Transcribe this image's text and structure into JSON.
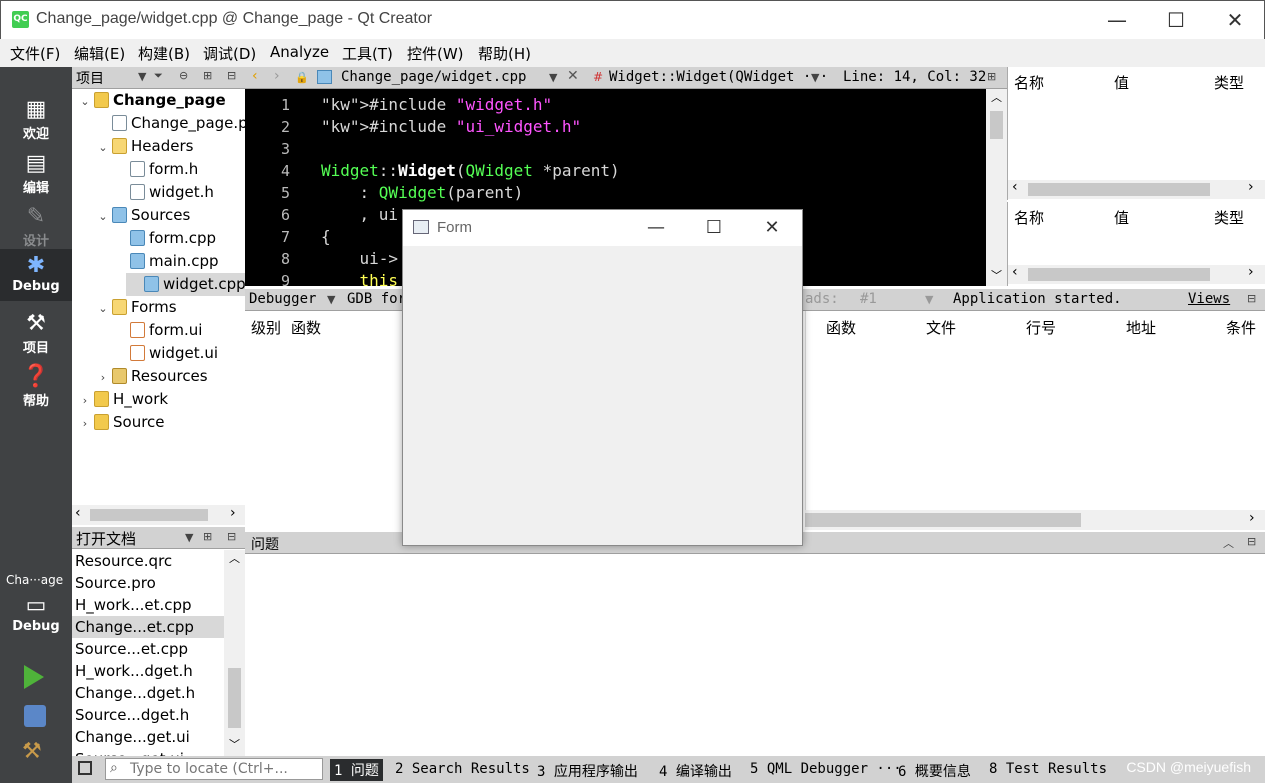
{
  "window": {
    "title": "Change_page/widget.cpp @ Change_page - Qt Creator",
    "logo": "QC",
    "minimize": "—",
    "maximize": "☐",
    "close": "✕"
  },
  "menu": [
    "文件(F)",
    "编辑(E)",
    "构建(B)",
    "调试(D)",
    "Analyze",
    "工具(T)",
    "控件(W)",
    "帮助(H)"
  ],
  "modes": [
    {
      "label": "欢迎",
      "icon": "grid-icon"
    },
    {
      "label": "编辑",
      "icon": "document-icon"
    },
    {
      "label": "设计",
      "icon": "pencil-icon"
    },
    {
      "label": "Debug",
      "icon": "bug-icon"
    },
    {
      "label": "项目",
      "icon": "wrench-icon"
    },
    {
      "label": "帮助",
      "icon": "help-icon"
    }
  ],
  "kit": {
    "project": "Cha···age",
    "config": "Debug"
  },
  "project_panel": {
    "title": "项目",
    "tree": [
      {
        "label": "Change_page",
        "depth": 0,
        "arrow": "v",
        "icon": "proj",
        "bold": true
      },
      {
        "label": "Change_page.pro",
        "depth": 1,
        "arrow": "",
        "icon": "file"
      },
      {
        "label": "Headers",
        "depth": 1,
        "arrow": "v",
        "icon": "hdr"
      },
      {
        "label": "form.h",
        "depth": 2,
        "arrow": "",
        "icon": "file"
      },
      {
        "label": "widget.h",
        "depth": 2,
        "arrow": "",
        "icon": "file"
      },
      {
        "label": "Sources",
        "depth": 1,
        "arrow": "v",
        "icon": "cpp"
      },
      {
        "label": "form.cpp",
        "depth": 2,
        "arrow": "",
        "icon": "cpp"
      },
      {
        "label": "main.cpp",
        "depth": 2,
        "arrow": "",
        "icon": "cpp"
      },
      {
        "label": "widget.cpp",
        "depth": 2,
        "arrow": "",
        "icon": "cpp",
        "selected": true
      },
      {
        "label": "Forms",
        "depth": 1,
        "arrow": "v",
        "icon": "hdr"
      },
      {
        "label": "form.ui",
        "depth": 2,
        "arrow": "",
        "icon": "ui"
      },
      {
        "label": "widget.ui",
        "depth": 2,
        "arrow": "",
        "icon": "ui"
      },
      {
        "label": "Resources",
        "depth": 1,
        "arrow": ">",
        "icon": "res"
      },
      {
        "label": "H_work",
        "depth": 0,
        "arrow": ">",
        "icon": "proj"
      },
      {
        "label": "Source",
        "depth": 0,
        "arrow": ">",
        "icon": "proj"
      }
    ]
  },
  "open_docs": {
    "title": "打开文档",
    "items": [
      "Resource.qrc",
      "Source.pro",
      "H_work...et.cpp",
      "Change...et.cpp",
      "Source...et.cpp",
      "H_work...dget.h",
      "Change...dget.h",
      "Source...dget.h",
      "Change...get.ui",
      "Source...get.ui"
    ],
    "selected_index": 3
  },
  "editor": {
    "file": "Change_page/widget.cpp",
    "symbol": "Widget::Widget(QWidget ···",
    "position": "Line: 14, Col: 32",
    "line_numbers": [
      "1",
      "2",
      "3",
      "4",
      "5",
      "6",
      "7",
      "8",
      "9"
    ],
    "code": [
      "#include \"widget.h\"",
      "#include \"ui_widget.h\"",
      "",
      "Widget::Widget(QWidget *parent)",
      "    : QWidget(parent)",
      "    , ui",
      "{",
      "    ui->",
      "    this"
    ]
  },
  "right_panel": {
    "headers": [
      "名称",
      "值",
      "类型"
    ]
  },
  "debugger_bar": {
    "label": "Debugger",
    "gdb": "GDB for",
    "threads": "ads:",
    "thread_num": "#1",
    "status": "Application started.",
    "views": "Views"
  },
  "stack": {
    "headers": [
      "级别",
      "函数"
    ]
  },
  "breakpoints": {
    "headers": [
      "函数",
      "文件",
      "行号",
      "地址",
      "条件"
    ]
  },
  "problems": {
    "title": "问题"
  },
  "status_bar": {
    "locate_placeholder": "Type to locate (Ctrl+...",
    "tabs": [
      "1 问题",
      "2 Search Results",
      "3 应用程序输出",
      "4 编译输出",
      "5 QML Debugger ···",
      "6 概要信息",
      "8 Test Results"
    ]
  },
  "form_window": {
    "title": "Form",
    "minimize": "—",
    "maximize": "☐",
    "close": "✕"
  },
  "watermark": "CSDN @meiyuefish"
}
